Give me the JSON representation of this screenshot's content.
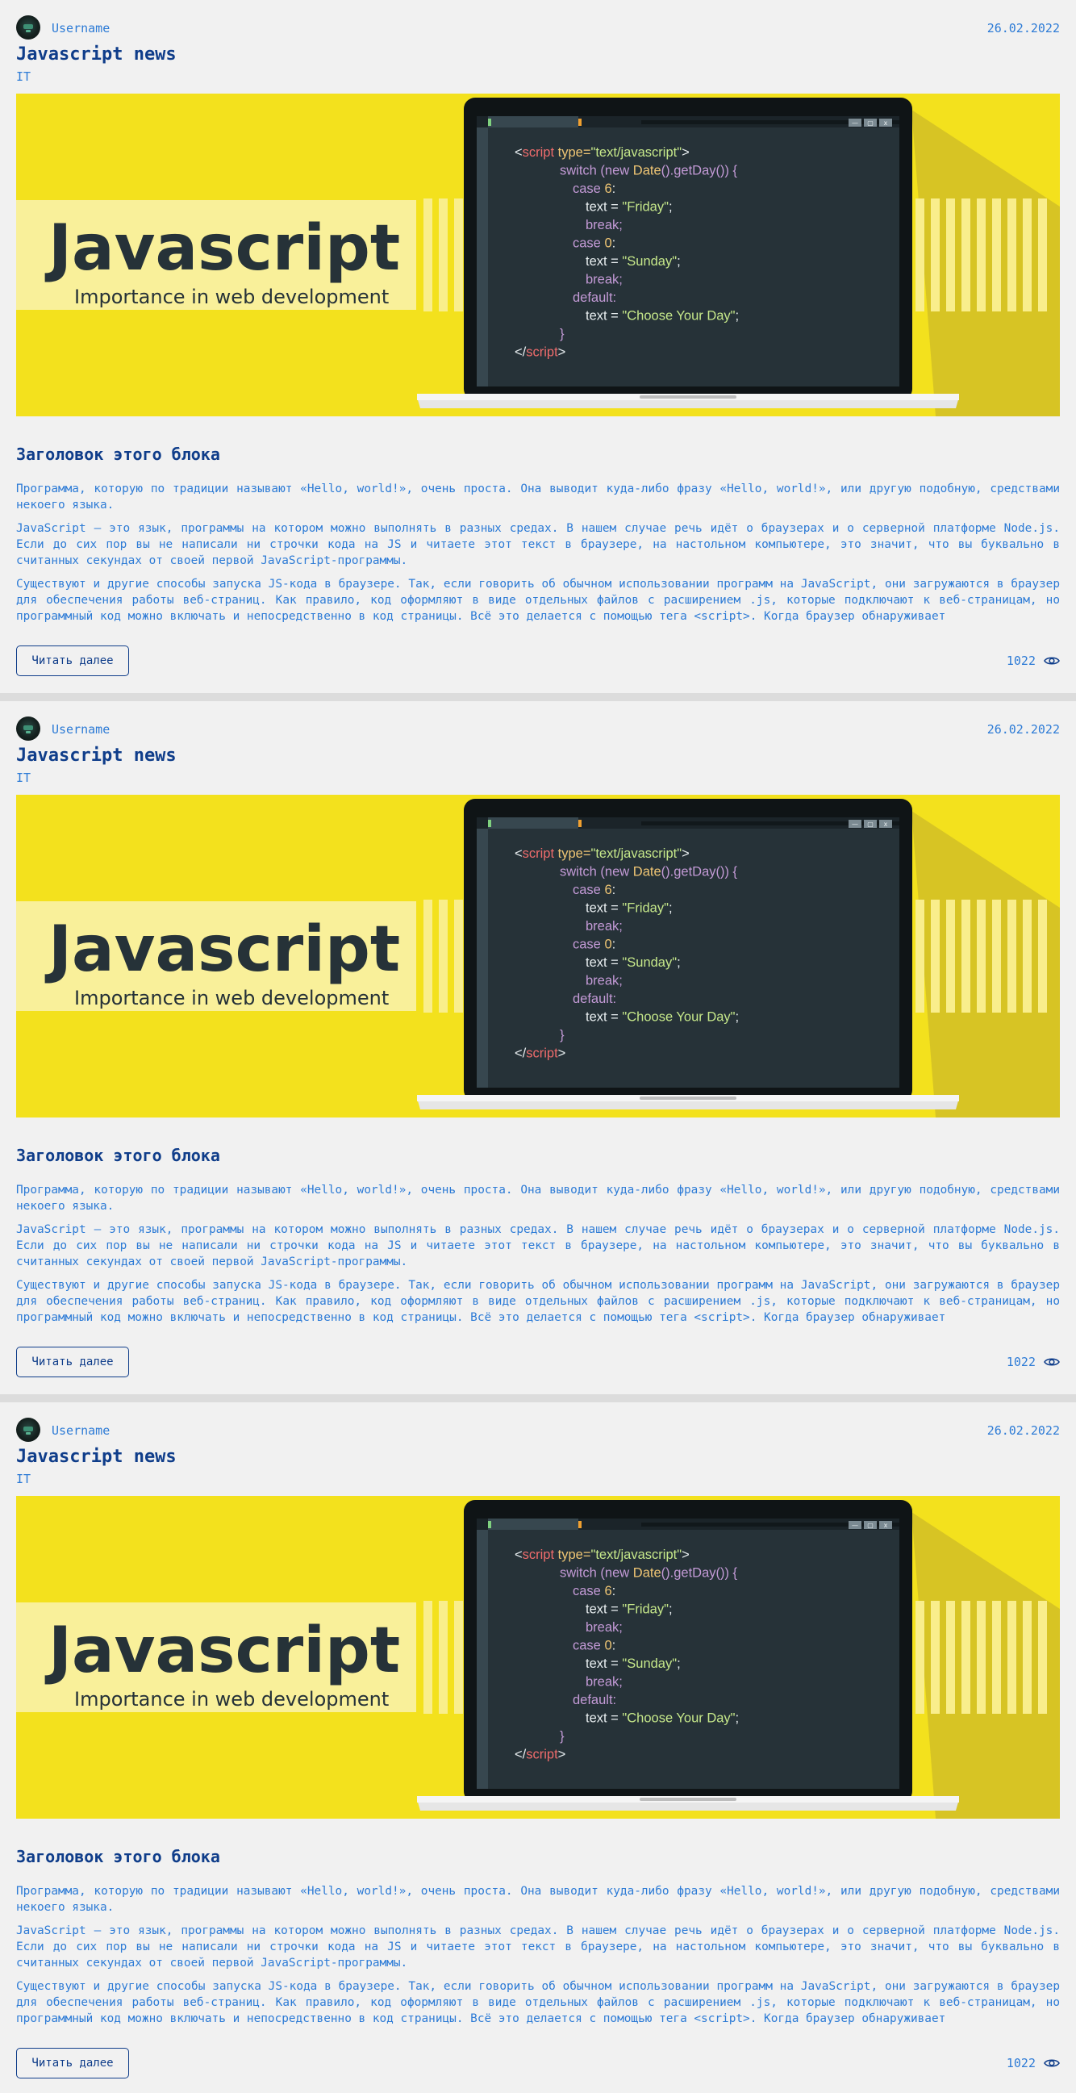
{
  "posts": [
    {
      "username": "Username",
      "date": "26.02.2022",
      "title": "Javascript news",
      "category": "IT",
      "heading": "Заголовок этого блока",
      "paragraphs": [
        "Программа, которую по традиции называют «Hello, world!», очень проста. Она выводит куда-либо фразу «Hello, world!», или другую подобную, средствами некоего языка.",
        "JavaScript — это язык, программы на котором можно выполнять в разных средах. В нашем случае речь идёт о браузерах и о серверной платформе Node.js. Если до сих пор вы не написали ни строчки кода на JS и читаете этот текст в браузере, на настольном компьютере, это значит, что вы буквально в считанных секундах от своей первой JavaScript-программы.",
        "Существуют и другие способы запуска JS-кода в браузере. Так, если говорить об обычном использовании программ на JavaScript, они загружаются в браузер для обеспечения работы веб-страниц. Как правило, код оформляют в виде отдельных файлов с расширением .js, которые подключают к веб-страницам, но программный код можно включать и непосредственно в код страницы. Всё это делается с помощью тега <script>. Когда браузер обнаруживает"
      ],
      "read_more": "Читать далее",
      "views": "1022"
    },
    {
      "username": "Username",
      "date": "26.02.2022",
      "title": "Javascript news",
      "category": "IT",
      "heading": "Заголовок этого блока",
      "paragraphs": [
        "Программа, которую по традиции называют «Hello, world!», очень проста. Она выводит куда-либо фразу «Hello, world!», или другую подобную, средствами некоего языка.",
        "JavaScript — это язык, программы на котором можно выполнять в разных средах. В нашем случае речь идёт о браузерах и о серверной платформе Node.js. Если до сих пор вы не написали ни строчки кода на JS и читаете этот текст в браузере, на настольном компьютере, это значит, что вы буквально в считанных секундах от своей первой JavaScript-программы.",
        "Существуют и другие способы запуска JS-кода в браузере. Так, если говорить об обычном использовании программ на JavaScript, они загружаются в браузер для обеспечения работы веб-страниц. Как правило, код оформляют в виде отдельных файлов с расширением .js, которые подключают к веб-страницам, но программный код можно включать и непосредственно в код страницы. Всё это делается с помощью тега <script>. Когда браузер обнаруживает"
      ],
      "read_more": "Читать далее",
      "views": "1022"
    },
    {
      "username": "Username",
      "date": "26.02.2022",
      "title": "Javascript news",
      "category": "IT",
      "heading": "Заголовок этого блока",
      "paragraphs": [
        "Программа, которую по традиции называют «Hello, world!», очень проста. Она выводит куда-либо фразу «Hello, world!», или другую подобную, средствами некоего языка.",
        "JavaScript — это язык, программы на котором можно выполнять в разных средах. В нашем случае речь идёт о браузерах и о серверной платформе Node.js. Если до сих пор вы не написали ни строчки кода на JS и читаете этот текст в браузере, на настольном компьютере, это значит, что вы буквально в считанных секундах от своей первой JavaScript-программы.",
        "Существуют и другие способы запуска JS-кода в браузере. Так, если говорить об обычном использовании программ на JavaScript, они загружаются в браузер для обеспечения работы веб-страниц. Как правило, код оформляют в виде отдельных файлов с расширением .js, которые подключают к веб-страницам, но программный код можно включать и непосредственно в код страницы. Всё это делается с помощью тега <script>. Когда браузер обнаруживает"
      ],
      "read_more": "Читать далее",
      "views": "1022"
    }
  ],
  "banner": {
    "headline": "Javascript",
    "subline": "Importance in web development",
    "code_lines": [
      [
        "<",
        "script",
        " type=",
        "\"text/javascript\"",
        ">"
      ],
      [
        "switch (new ",
        "Date",
        "().getDay()) {"
      ],
      [
        "case ",
        "6",
        ":"
      ],
      [
        "text = ",
        "\"Friday\"",
        ";"
      ],
      [
        "break;"
      ],
      [
        "case ",
        "0",
        ":"
      ],
      [
        "text = ",
        "\"Sunday\"",
        ";"
      ],
      [
        "break;"
      ],
      [
        "default:"
      ],
      [
        "text = ",
        "\"Choose Your Day\"",
        ";"
      ],
      [
        "}"
      ],
      [
        "</",
        "script",
        ">"
      ]
    ],
    "window_buttons": [
      "—",
      "▢",
      "x"
    ]
  },
  "icons": {
    "avatar": "avatar-image",
    "views": "eye-icon"
  },
  "colors": {
    "title": "#0f3d8a",
    "accent": "#2d7bd6",
    "banner_bg": "#f3e11d",
    "banner_text": "#263238"
  }
}
